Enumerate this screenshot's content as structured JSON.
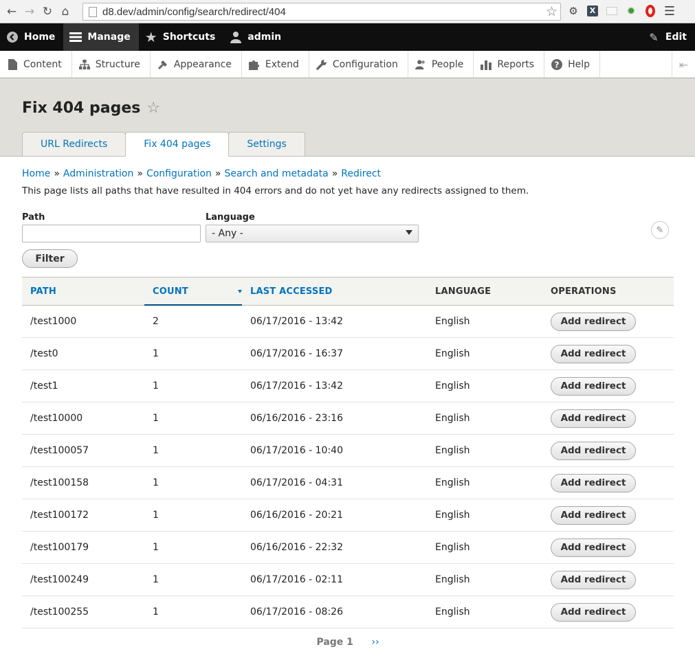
{
  "browser": {
    "url": "d8.dev/admin/config/search/redirect/404"
  },
  "toolbar": {
    "home": "Home",
    "manage": "Manage",
    "shortcuts": "Shortcuts",
    "user": "admin",
    "edit": "Edit"
  },
  "tray": {
    "items": [
      "Content",
      "Structure",
      "Appearance",
      "Extend",
      "Configuration",
      "People",
      "Reports",
      "Help"
    ]
  },
  "page": {
    "title": "Fix 404 pages",
    "tabs": [
      "URL Redirects",
      "Fix 404 pages",
      "Settings"
    ],
    "active_tab": 1
  },
  "breadcrumb": [
    "Home",
    "Administration",
    "Configuration",
    "Search and metadata",
    "Redirect"
  ],
  "description": "This page lists all paths that have resulted in 404 errors and do not yet have any redirects assigned to them.",
  "filters": {
    "path_label": "Path",
    "path_value": "",
    "language_label": "Language",
    "language_value": "- Any -",
    "submit": "Filter"
  },
  "table": {
    "headers": [
      "PATH",
      "COUNT",
      "LAST ACCESSED",
      "LANGUAGE",
      "OPERATIONS"
    ],
    "rows": [
      {
        "path": "/test1000",
        "count": "2",
        "last": "06/17/2016 - 13:42",
        "lang": "English",
        "op": "Add redirect"
      },
      {
        "path": "/test0",
        "count": "1",
        "last": "06/17/2016 - 16:37",
        "lang": "English",
        "op": "Add redirect"
      },
      {
        "path": "/test1",
        "count": "1",
        "last": "06/17/2016 - 13:42",
        "lang": "English",
        "op": "Add redirect"
      },
      {
        "path": "/test10000",
        "count": "1",
        "last": "06/16/2016 - 23:16",
        "lang": "English",
        "op": "Add redirect"
      },
      {
        "path": "/test100057",
        "count": "1",
        "last": "06/17/2016 - 10:40",
        "lang": "English",
        "op": "Add redirect"
      },
      {
        "path": "/test100158",
        "count": "1",
        "last": "06/17/2016 - 04:31",
        "lang": "English",
        "op": "Add redirect"
      },
      {
        "path": "/test100172",
        "count": "1",
        "last": "06/16/2016 - 20:21",
        "lang": "English",
        "op": "Add redirect"
      },
      {
        "path": "/test100179",
        "count": "1",
        "last": "06/16/2016 - 22:32",
        "lang": "English",
        "op": "Add redirect"
      },
      {
        "path": "/test100249",
        "count": "1",
        "last": "06/17/2016 - 02:11",
        "lang": "English",
        "op": "Add redirect"
      },
      {
        "path": "/test100255",
        "count": "1",
        "last": "06/17/2016 - 08:26",
        "lang": "English",
        "op": "Add redirect"
      }
    ]
  },
  "pager": {
    "current": "Page 1",
    "next": "››"
  }
}
